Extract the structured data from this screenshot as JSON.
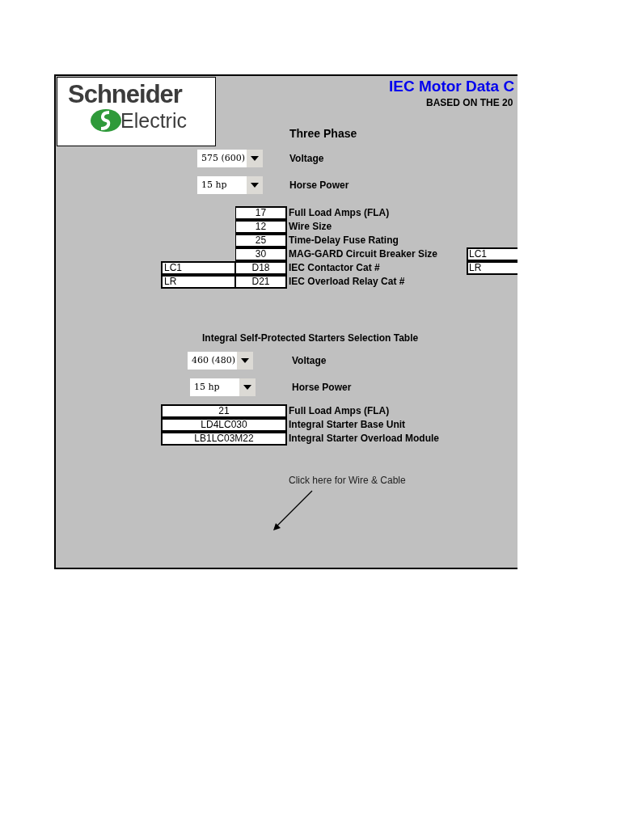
{
  "logo": {
    "brand": "Schneider",
    "sub": "Electric"
  },
  "title": "IEC Motor Data C",
  "subtitle": "BASED ON THE 20",
  "section1": {
    "heading": "Three Phase",
    "selects": [
      {
        "value": "575 (600)",
        "label": "Voltage"
      },
      {
        "value": "15 hp",
        "label": "Horse Power"
      }
    ],
    "rows": [
      {
        "prefix": null,
        "value": "17",
        "label": "Full Load Amps (FLA)",
        "side": null
      },
      {
        "prefix": null,
        "value": "12",
        "label": "Wire Size",
        "side": null
      },
      {
        "prefix": null,
        "value": "25",
        "label": "Time-Delay Fuse Rating",
        "side": null
      },
      {
        "prefix": null,
        "value": "30",
        "label": "MAG-GARD Circuit Breaker Size",
        "side": "LC1"
      },
      {
        "prefix": "LC1",
        "value": "D18",
        "label": "IEC Contactor Cat #",
        "side": "LR"
      },
      {
        "prefix": "LR",
        "value": "D21",
        "label": "IEC Overload Relay Cat #",
        "side": null
      }
    ]
  },
  "section2": {
    "heading": "Integral Self-Protected Starters Selection Table",
    "selects": [
      {
        "value": "460 (480)",
        "label": "Voltage"
      },
      {
        "value": "15 hp",
        "label": "Horse Power"
      }
    ],
    "rows": [
      {
        "value": "21",
        "label": "Full Load Amps (FLA)"
      },
      {
        "value": "LD4LC030",
        "label": "Integral Starter Base Unit"
      },
      {
        "value": "LB1LC03M22",
        "label": "Integral Starter Overload Module"
      }
    ]
  },
  "link": "Click here for Wire & Cable"
}
